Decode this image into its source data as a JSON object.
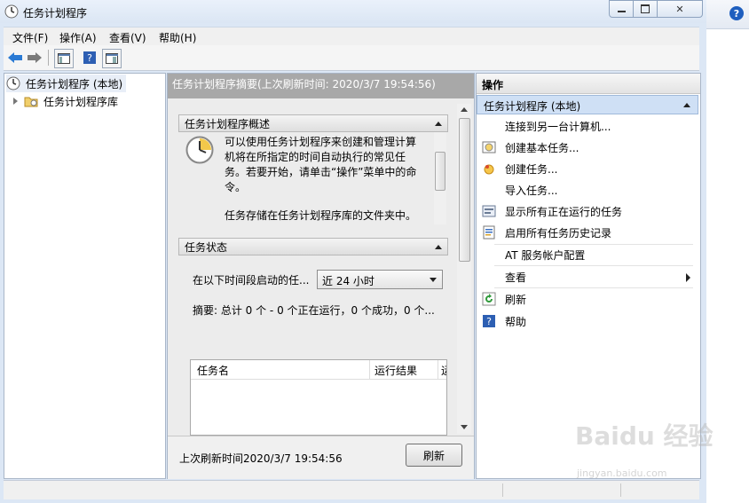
{
  "window": {
    "title": "任务计划程序",
    "min_label": "▭",
    "max_label": "□",
    "close_label": "✕"
  },
  "menu": [
    "文件(F)",
    "操作(A)",
    "查看(V)",
    "帮助(H)"
  ],
  "tree": {
    "root": "任务计划程序 (本地)",
    "child": "任务计划程序库"
  },
  "center": {
    "header": "任务计划程序摘要(上次刷新时间: 2020/3/7 19:54:56)",
    "overview": {
      "title": "任务计划程序概述",
      "text1": "可以使用任务计划程序来创建和管理计算机将在所指定的时间自动执行的常见任务。若要开始，请单击“操作”菜单中的命令。",
      "text2": "任务存储在任务计划程序库的文件夹中。"
    },
    "status": {
      "title": "任务状态",
      "filter_label": "在以下时间段启动的任...",
      "filter_value": "近 24 小时",
      "summary": "摘要: 总计 0 个 - 0 个正在运行，0 个成功，0 个...",
      "columns": [
        "任务名",
        "运行结果",
        "运"
      ]
    },
    "last_refresh": "上次刷新时间2020/3/7 19:54:56",
    "refresh_button": "刷新"
  },
  "actions": {
    "header": "操作",
    "group": "任务计划程序 (本地)",
    "items": [
      {
        "label": "连接到另一台计算机...",
        "icon": "none"
      },
      {
        "label": "创建基本任务...",
        "icon": "create-basic-task-icon"
      },
      {
        "label": "创建任务...",
        "icon": "create-task-icon"
      },
      {
        "label": "导入任务...",
        "icon": "none"
      },
      {
        "label": "显示所有正在运行的任务",
        "icon": "running-tasks-icon"
      },
      {
        "label": "启用所有任务历史记录",
        "icon": "history-icon"
      },
      {
        "label": "AT 服务帐户配置",
        "icon": "none"
      },
      {
        "label": "查看",
        "icon": "none"
      },
      {
        "label": "刷新",
        "icon": "refresh-icon"
      },
      {
        "label": "帮助",
        "icon": "help-icon"
      }
    ]
  },
  "watermark": {
    "main": "Baidu 经验",
    "sub": "jingyan.baidu.com"
  },
  "colors": {
    "accent": "#1f5fbf",
    "action_group_bg": "#cfe0f5",
    "center_header_bg": "#a8a8a8"
  }
}
